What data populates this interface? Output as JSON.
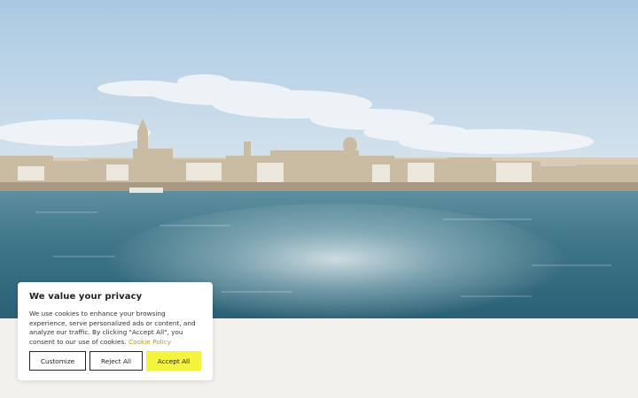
{
  "hero": {
    "image": "waterfront-old-town-seascape"
  },
  "cookie_banner": {
    "title": "We value your privacy",
    "body": "We use cookies to enhance your browsing experience, serve personalized ads or content, and analyze our traffic. By clicking \"Accept All\", you consent to our use of cookies.",
    "policy_link": "Cookie Policy",
    "customize_label": "Customize",
    "reject_label": "Reject All",
    "accept_label": "Accept All"
  },
  "colors": {
    "accept_button": "#f4f43c",
    "page_background": "#f2f1ee",
    "link": "#b59a2a"
  }
}
